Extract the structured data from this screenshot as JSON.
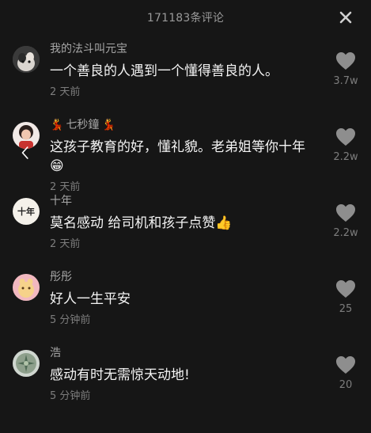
{
  "header": {
    "title": "171183条评论"
  },
  "comments": [
    {
      "username": "我的法斗叫元宝",
      "text": "一个善良的人遇到一个懂得善良的人。",
      "time": "2 天前",
      "likes": "3.7w"
    },
    {
      "username": "七秒鐘",
      "username_emoji": "💃",
      "text": "这孩子教育的好，懂礼貌。老弟姐等你十年",
      "text_emoji": "😁",
      "time": "2 天前",
      "likes": "2.2w"
    },
    {
      "username": "十年",
      "avatar_text": "十年",
      "text": "莫名感动 给司机和孩子点赞",
      "text_emoji": "👍",
      "time": "2 天前",
      "likes": "2.2w"
    },
    {
      "username": "彤彤",
      "text": "好人一生平安",
      "time": "5 分钟前",
      "likes": "25"
    },
    {
      "username": "浩",
      "text": "感动有时无需惊天动地!",
      "time": "5 分钟前",
      "likes": "20"
    }
  ],
  "colors": {
    "background": "#161616",
    "heart": "#8e8e8e",
    "text_primary": "#f4f4f4",
    "text_secondary": "#a6a6a6"
  },
  "icons": {
    "close": "close-icon",
    "like": "heart-icon",
    "back": "chevron-left-icon"
  }
}
